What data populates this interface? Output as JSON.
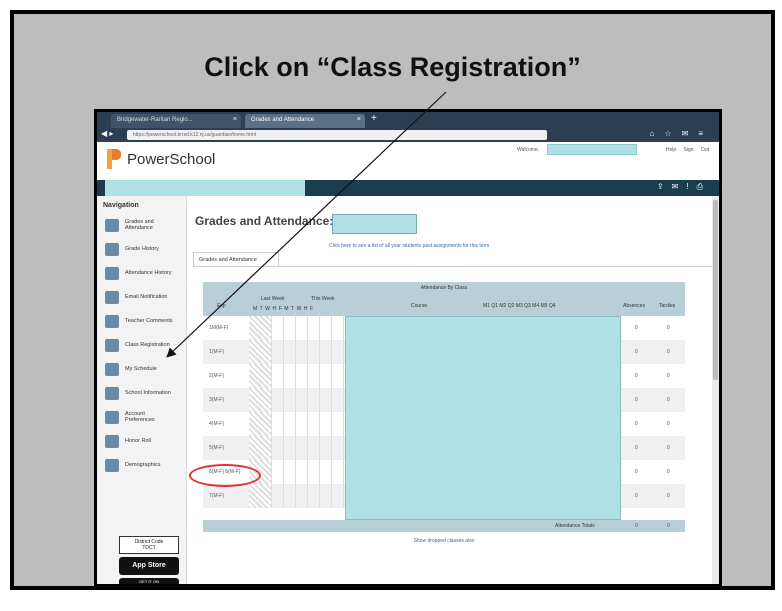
{
  "slide": {
    "instruction": "Click on “Class Registration”"
  },
  "browser": {
    "tab1": "Bridgewater-Raritan Regio...",
    "tab2": "Grades and Attendance",
    "url": "https://powerschool.brrsd.k12.nj.us/guardian/home.html",
    "new_tab": "+"
  },
  "header": {
    "brand": "PowerSchool",
    "welcome_label": "Welcome,",
    "help": "Help",
    "sign_out": "Sign Out"
  },
  "sidebar": {
    "title": "Navigation",
    "items": [
      {
        "label": "Grades and Attendance",
        "icon": "grades-icon"
      },
      {
        "label": "Grade History",
        "icon": "history-icon"
      },
      {
        "label": "Attendance History",
        "icon": "attendance-icon"
      },
      {
        "label": "Email Notification",
        "icon": "email-icon"
      },
      {
        "label": "Teacher Comments",
        "icon": "comments-icon"
      },
      {
        "label": "Class Registration",
        "icon": "registration-icon"
      },
      {
        "label": "My Schedule",
        "icon": "schedule-icon"
      },
      {
        "label": "School Information",
        "icon": "school-icon"
      },
      {
        "label": "Account Preferences",
        "icon": "preferences-icon"
      },
      {
        "label": "Honor Roll",
        "icon": "honor-roll-icon"
      },
      {
        "label": "Demographics",
        "icon": "demographics-icon"
      }
    ],
    "district_code_label": "District Code",
    "district_code": "TDCT",
    "app_store": "App Store",
    "google_play": "GET IT ON"
  },
  "main": {
    "title": "Grades and Attendance:",
    "assignments_link": "Click here to see a list of all your students past assignments for this term.",
    "subtab": "Grades and Attendance",
    "table": {
      "group_header": "Attendance By Class",
      "exp_header": "Exp",
      "last_week": "Last Week",
      "this_week": "This Week",
      "days": "M T W H F M T W H F",
      "course_header": "Course",
      "terms": "M1 Q1 M2 Q2 M3 Q3 M4 M5 Q4",
      "absences": "Absences",
      "tardies": "Tardies",
      "rows": [
        {
          "exp": "1M(M-F)",
          "abs": "0",
          "tar": "0"
        },
        {
          "exp": "1(M-F)",
          "abs": "0",
          "tar": "0"
        },
        {
          "exp": "2(M-F)",
          "abs": "0",
          "tar": "0"
        },
        {
          "exp": "3(M-F)",
          "abs": "0",
          "tar": "0"
        },
        {
          "exp": "4(M-F)",
          "abs": "0",
          "tar": "0"
        },
        {
          "exp": "5(M-F)",
          "abs": "0",
          "tar": "0"
        },
        {
          "exp": "6(M-F) 6(M-F)",
          "abs": "0",
          "tar": "0"
        },
        {
          "exp": "7(M-F)",
          "abs": "0",
          "tar": "0"
        }
      ],
      "totals_label": "Attendance Totals",
      "totals_abs": "0",
      "totals_tar": "0"
    },
    "dropped_link": "Show dropped classes also"
  },
  "colors": {
    "accent_callout": "#e03030",
    "header_bar": "#1a3c4d",
    "redaction": "#aee0e6"
  }
}
